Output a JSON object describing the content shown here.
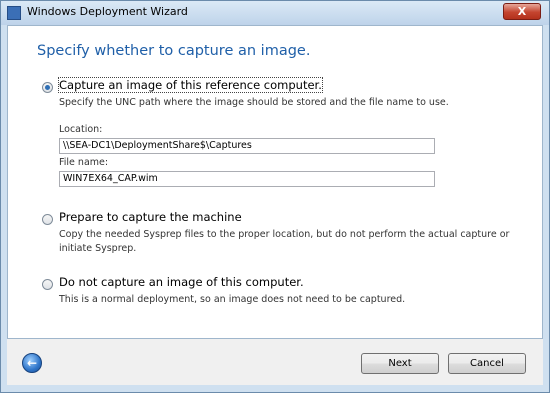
{
  "window": {
    "title": "Windows Deployment Wizard",
    "close_glyph": "X"
  },
  "page": {
    "heading": "Specify whether to capture an image."
  },
  "options": [
    {
      "label": "Capture an image of this reference computer.",
      "selected": true,
      "description": "Specify the UNC path where the image should be stored and the file name to use."
    },
    {
      "label": "Prepare to capture the machine",
      "selected": false,
      "description": "Copy the needed Sysprep files to the proper location, but do not perform the actual capture or initiate Sysprep."
    },
    {
      "label": "Do not capture an image of this computer.",
      "selected": false,
      "description": "This is a normal deployment, so an image does not need to be captured."
    }
  ],
  "location": {
    "label": "Location:",
    "value": "\\\\SEA-DC1\\DeploymentShare$\\Captures"
  },
  "file_name": {
    "label": "File name:",
    "value": "WIN7EX64_CAP.wim"
  },
  "buttons": {
    "next": "Next",
    "cancel": "Cancel",
    "back_icon": "back-arrow-icon"
  },
  "colors": {
    "heading": "#1f5fa8",
    "close_button": "#c4442f",
    "back_button": "#2f75c9"
  }
}
